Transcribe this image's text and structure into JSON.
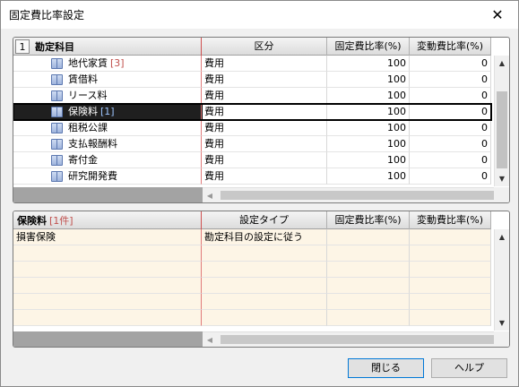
{
  "window": {
    "title": "固定費比率設定"
  },
  "top_grid": {
    "level": "1",
    "headers": [
      "勘定科目",
      "区分",
      "固定費比率(%)",
      "変動費比率(%)"
    ],
    "rows": [
      {
        "name": "地代家賃",
        "count": "[3]",
        "kubun": "費用",
        "fixed": "100",
        "variable": "0"
      },
      {
        "name": "賃借料",
        "count": "",
        "kubun": "費用",
        "fixed": "100",
        "variable": "0"
      },
      {
        "name": "リース料",
        "count": "",
        "kubun": "費用",
        "fixed": "100",
        "variable": "0"
      },
      {
        "name": "保険料",
        "count": "[1]",
        "kubun": "費用",
        "fixed": "100",
        "variable": "0"
      },
      {
        "name": "租税公課",
        "count": "",
        "kubun": "費用",
        "fixed": "100",
        "variable": "0"
      },
      {
        "name": "支払報酬料",
        "count": "",
        "kubun": "費用",
        "fixed": "100",
        "variable": "0"
      },
      {
        "name": "寄付金",
        "count": "",
        "kubun": "費用",
        "fixed": "100",
        "variable": "0"
      },
      {
        "name": "研究開発費",
        "count": "",
        "kubun": "費用",
        "fixed": "100",
        "variable": "0"
      }
    ],
    "selected_index": 3
  },
  "bottom_grid": {
    "title": "保険料",
    "count": "[1件]",
    "headers": [
      "設定タイプ",
      "固定費比率(%)",
      "変動費比率(%)"
    ],
    "rows": [
      {
        "name": "損害保険",
        "type": "勘定科目の設定に従う",
        "fixed": "",
        "variable": ""
      }
    ]
  },
  "buttons": {
    "close": "閉じる",
    "help": "ヘルプ"
  },
  "icons": {
    "close": "close-icon",
    "account": "book-icon",
    "scroll_up": "arrow-up-icon",
    "scroll_down": "arrow-down-icon",
    "scroll_left": "arrow-left-icon",
    "scroll_right": "arrow-right-icon"
  },
  "colors": {
    "count_red": "#c0504d",
    "selected_bg": "#1f1f1f",
    "subgrid_row": "#fdf5e6"
  }
}
